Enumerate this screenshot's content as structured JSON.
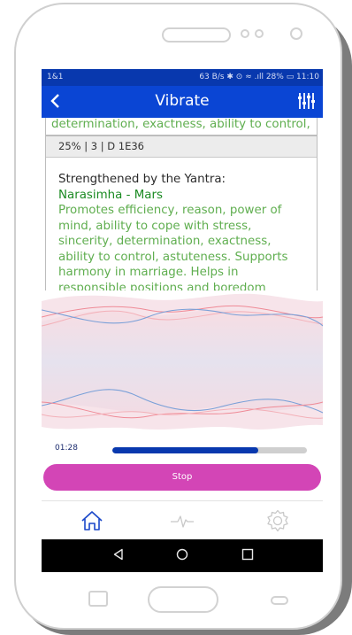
{
  "statusbar": {
    "carrier": "1&1",
    "info": "63 B/s ✱ ⊙ ≈ .ıll 28% ▭ 11:10"
  },
  "appbar": {
    "title": "Vibrate",
    "back_icon": "chevron-left-icon",
    "settings_icon": "equalizer-icon"
  },
  "prev_card": {
    "text": "determination, exactness, ability to control,"
  },
  "card": {
    "meta": "25% | 3 | D 1E36",
    "label": "Strengthened by the Yantra:",
    "yantra": "Narasimha - Mars",
    "description": "Promotes efficiency, reason, power of mind, ability to cope with stress, sincerity, determination, exactness, ability to control, astuteness. Supports harmony in marriage. Helps in responsible positions and boredom"
  },
  "player": {
    "time": "01:28",
    "progress": 0.75,
    "stop_label": "Stop"
  },
  "colors": {
    "statusbar": "#0838ae",
    "appbar": "#0a45d4",
    "accent_green": "#5fae4f",
    "stop_button": "#d345b6",
    "wave_red": "#f08090",
    "wave_blue": "#7aa0d8"
  },
  "nav": {
    "home_icon": "home-icon",
    "pulse_icon": "pulse-icon",
    "settings_icon": "gear-icon"
  }
}
